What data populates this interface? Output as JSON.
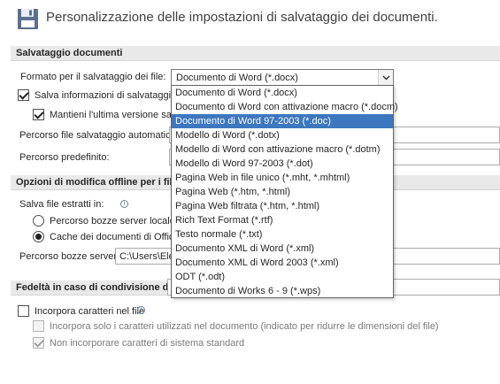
{
  "header": {
    "icon": "floppy-disk-icon",
    "title": "Personalizzazione delle impostazioni di salvataggio dei documenti."
  },
  "sections": {
    "save": {
      "title": "Salvataggio documenti"
    },
    "offline": {
      "title": "Opzioni di modifica offline per i file d"
    },
    "fidelity": {
      "title": "Fedeltà in caso di condivisione di:"
    }
  },
  "save": {
    "format_label": "Formato per il salvataggio dei file:",
    "format_selected": "Documento di Word (*.docx)",
    "autorecover_label": "Salva informazioni di salvataggio a",
    "autorecover_checked": true,
    "keep_last_label": "Mantieni l'ultima versione salvat",
    "keep_last_checked": true,
    "autorecover_path_label": "Percorso file salvataggio automatico:",
    "default_path_label": "Percorso predefinito:"
  },
  "format_options": [
    "Documento di Word (*.docx)",
    "Documento di Word con attivazione macro (*.docm)",
    "Documento di Word 97-2003 (*.doc)",
    "Modello di Word (*.dotx)",
    "Modello di Word con attivazione macro (*.dotm)",
    "Modello di Word 97-2003 (*.dot)",
    "Pagina Web in file unico (*.mht, *.mhtml)",
    "Pagina Web (*.htm, *.html)",
    "Pagina Web filtrata (*.htm, *.html)",
    "Rich Text Format (*.rtf)",
    "Testo normale (*.txt)",
    "Documento XML di Word (*.xml)",
    "Documento XML di Word 2003 (*.xml)",
    "ODT (*.odt)",
    "Documento di Works 6 - 9 (*.wps)"
  ],
  "format_highlighted_index": 2,
  "offline": {
    "save_checked_out_label": "Salva file estratti in:",
    "radio_server_drafts": "Percorso bozze server locale ne",
    "radio_office_cache": "Cache dei documenti di Office",
    "selected_radio": "office_cache",
    "drafts_path_label": "Percorso bozze server:",
    "drafts_path_value": "C:\\Users\\Elen"
  },
  "fidelity": {
    "embed_fonts_label": "Incorpora caratteri nel file",
    "embed_fonts_checked": false,
    "embed_used_only_label": "Incorpora solo i caratteri utilizzati nel documento (indicato per ridurre le dimensioni del file)",
    "embed_used_only_checked": false,
    "no_common_fonts_label": "Non incorporare caratteri di sistema standard",
    "no_common_fonts_checked": true
  },
  "colors": {
    "section_bar": "#e9e9e9",
    "highlight": "#3c77c0",
    "disabled_text": "#7a7a7a"
  }
}
